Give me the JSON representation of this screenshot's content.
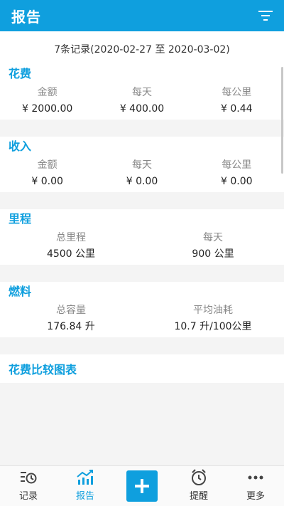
{
  "header": {
    "title": "报告"
  },
  "records": {
    "text": "7条记录(2020-02-27 至 2020-03-02)"
  },
  "sections": [
    {
      "title": "花费",
      "labels": [
        "金额",
        "每天",
        "每公里"
      ],
      "values": [
        "¥ 2000.00",
        "¥ 400.00",
        "¥ 0.44"
      ]
    },
    {
      "title": "收入",
      "labels": [
        "金额",
        "每天",
        "每公里"
      ],
      "values": [
        "¥ 0.00",
        "¥ 0.00",
        "¥ 0.00"
      ]
    },
    {
      "title": "里程",
      "labels": [
        "总里程",
        "每天"
      ],
      "values": [
        "4500 公里",
        "900 公里"
      ]
    },
    {
      "title": "燃料",
      "labels": [
        "总容量",
        "平均油耗"
      ],
      "values": [
        "176.84 升",
        "10.7 升/100公里"
      ]
    }
  ],
  "chart": {
    "title": "花费比较图表"
  },
  "nav": {
    "items": [
      {
        "label": "记录",
        "icon": "record-icon"
      },
      {
        "label": "报告",
        "icon": "report-icon",
        "active": true
      },
      {
        "label": "",
        "icon": "add-icon"
      },
      {
        "label": "提醒",
        "icon": "alarm-icon"
      },
      {
        "label": "更多",
        "icon": "more-icon"
      }
    ]
  },
  "colors": {
    "accent": "#0f9fde"
  }
}
